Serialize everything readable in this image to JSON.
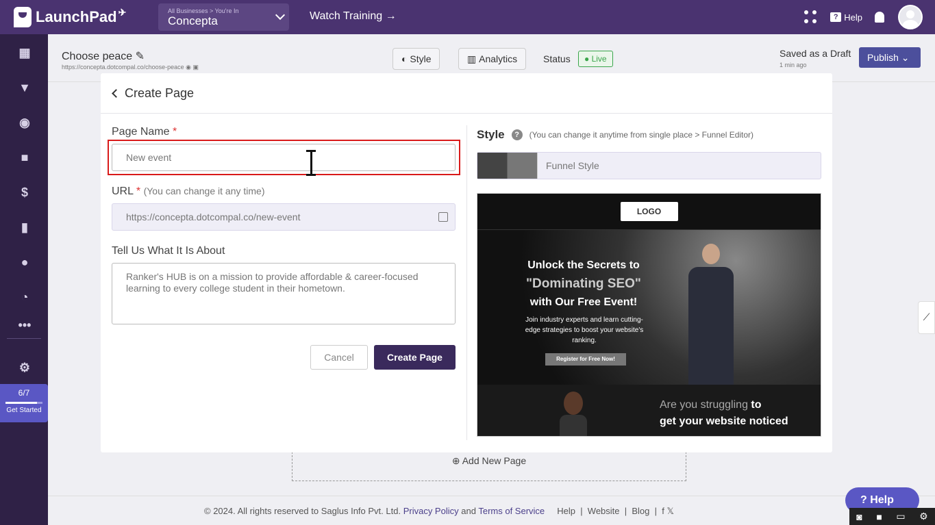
{
  "topbar": {
    "brand": "LaunchPad",
    "business_breadcrumb": "All Businesses > You're In",
    "business_name": "Concepta",
    "watch_training": "Watch Training →",
    "help_label": "Help"
  },
  "sidebar": {
    "items": [
      {
        "icon": "dashboard-icon"
      },
      {
        "icon": "funnel-icon"
      },
      {
        "icon": "globe-icon"
      },
      {
        "icon": "video-icon"
      },
      {
        "icon": "dollar-icon"
      },
      {
        "icon": "analytics-icon"
      },
      {
        "icon": "users-icon"
      },
      {
        "icon": "gauge-icon"
      },
      {
        "icon": "more-icon"
      },
      {
        "icon": "settings-icon"
      }
    ],
    "progress": {
      "count": "6/7",
      "fraction": 0.857,
      "label": "Get Started"
    }
  },
  "header": {
    "page_title": "Choose peace",
    "page_url": "https://concepta.dotcompal.co/choose-peace",
    "style_btn": "Style",
    "analytics_btn": "Analytics",
    "status_label": "Status",
    "status_value": "Live",
    "saved": "Saved as a Draft",
    "saved_time": "1 min ago",
    "publish": "Publish"
  },
  "modal": {
    "title": "Create Page",
    "page_name_label": "Page Name",
    "required_mark": "*",
    "page_name_value": "New event",
    "url_label": "URL",
    "url_hint": "(You can change it any time)",
    "url_value": "https://concepta.dotcompal.co/new-event",
    "about_label": "Tell Us What It Is About",
    "about_value": "Ranker's HUB is on a mission to provide affordable & career-focused learning to every college student in their hometown.",
    "cancel": "Cancel",
    "create": "Create Page",
    "style_title": "Style",
    "style_hint": "(You can change it anytime from single place > Funnel Editor)",
    "funnel_style": "Funnel Style",
    "preview": {
      "logo": "LOGO",
      "h1_a": "Unlock the Secrets to",
      "h1_b": "\"Dominating SEO\"",
      "h1_c": "with Our Free Event!",
      "body": "Join industry experts and learn cutting-edge strategies to boost your website's ranking.",
      "cta": "Register for Free Now!",
      "bottom_dim": "Are you struggling",
      "bottom_a": "to",
      "bottom_b": "get your website noticed"
    }
  },
  "page": {
    "add_new_page": "Add New Page",
    "footer_copy": "© 2024. All rights reserved to Saglus Info Pvt. Ltd.",
    "privacy": "Privacy Policy",
    "and": "and",
    "terms": "Terms of Service",
    "help": "Help",
    "website": "Website",
    "blog": "Blog",
    "help_float": "Help"
  }
}
